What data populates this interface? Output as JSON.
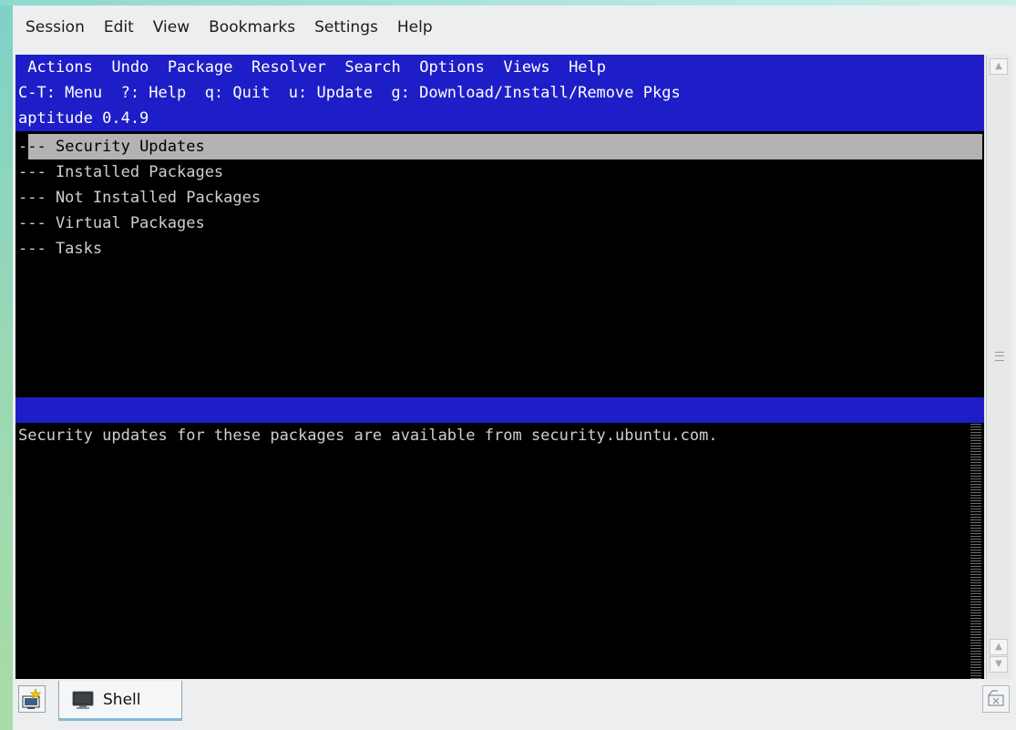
{
  "menubar": {
    "items": [
      "Session",
      "Edit",
      "View",
      "Bookmarks",
      "Settings",
      "Help"
    ]
  },
  "terminal": {
    "app_menu": [
      "Actions",
      "Undo",
      "Package",
      "Resolver",
      "Search",
      "Options",
      "Views",
      "Help"
    ],
    "keys_hint": "C-T: Menu  ?: Help  q: Quit  u: Update  g: Download/Install/Remove Pkgs",
    "version": "aptitude 0.4.9",
    "tree": [
      {
        "prefix": "-",
        "label": "-- Security Updates"
      },
      {
        "label": "--- Installed Packages"
      },
      {
        "label": "--- Not Installed Packages"
      },
      {
        "label": "--- Virtual Packages"
      },
      {
        "label": "--- Tasks"
      }
    ],
    "description": "Security updates for these packages are available from security.ubuntu.com."
  },
  "tabs": [
    {
      "label": "Shell",
      "icon": "terminal-icon"
    }
  ],
  "icons": {
    "new_tab": "new-tab-icon",
    "close_tab": "close-tab-icon"
  },
  "colors": {
    "terminal_bg": "#000000",
    "header_blue": "#1e1ec8",
    "selection_gray": "#b3b3b3"
  }
}
